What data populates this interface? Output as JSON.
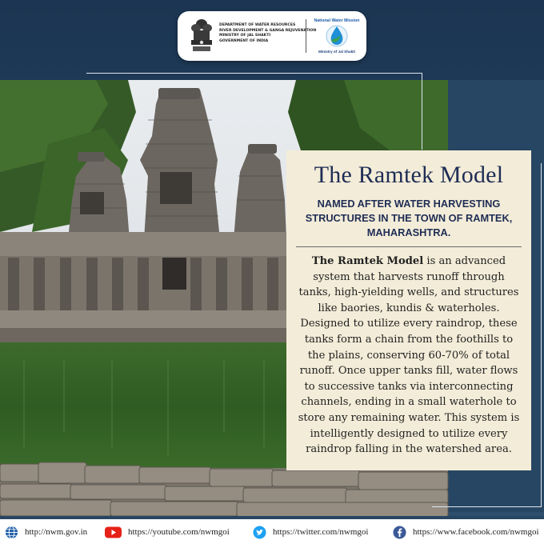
{
  "header": {
    "dept_lines": [
      "DEPARTMENT OF WATER RESOURCES",
      "RIVER DEVELOPMENT & GANGA REJUVENATION",
      "MINISTRY OF JAL SHAKTI",
      "GOVERNMENT OF INDIA"
    ],
    "mission_logo_top": "National Water Mission",
    "mission_logo_bottom": "Ministry of Jal Shakti"
  },
  "card": {
    "title": "The Ramtek Model",
    "subtitle": "NAMED AFTER WATER HARVESTING STRUCTURES IN THE TOWN OF RAMTEK, MAHARASHTRA.",
    "body_lead": "The Ramtek Model",
    "body_rest": " is an advanced system that harvests runoff through tanks, high-yielding wells, and structures like baories, kundis & waterholes. Designed to utilize every raindrop, these tanks form a chain from the foothills to the plains, conserving 60-70% of total runoff. Once upper tanks fill, water flows to successive tanks via interconnecting channels, ending in a small waterhole to store any remaining water. This system is intelligently designed to utilize every raindrop falling in the watershed area."
  },
  "footer": {
    "website": "http://nwm.gov.in",
    "youtube": "https://youtube.com/nwmgoi",
    "twitter": "https://twitter.com/nwmgoi",
    "facebook": "https://www.facebook.com/nwmgoi"
  },
  "colors": {
    "title_navy": "#1f2d55",
    "card_bg": "#f3ecd8",
    "background": "#1e3a5a",
    "youtube_red": "#e62117",
    "twitter_blue": "#1da1f2",
    "facebook_blue": "#3b5998"
  },
  "icons": [
    "national-emblem-icon",
    "water-drop-logo-icon",
    "globe-icon",
    "youtube-icon",
    "twitter-icon",
    "facebook-icon"
  ]
}
